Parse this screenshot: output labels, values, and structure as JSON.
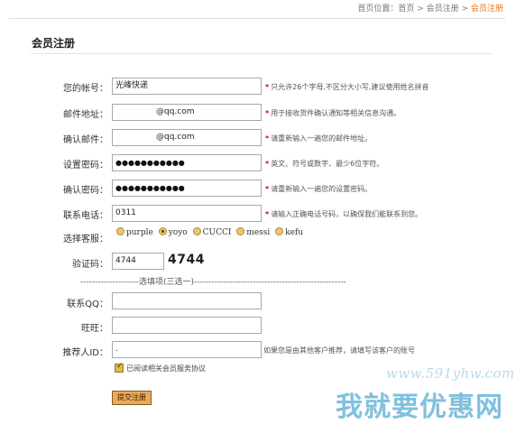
{
  "breadcrumb": {
    "prefix": "首页位置：",
    "home": "首页",
    "sep": ">",
    "members": "会员注册",
    "current": "会员注册"
  },
  "page_title": "会员注册",
  "fields": {
    "account": {
      "label": "您的帐号：",
      "value": "光峰快递",
      "hint": "只允许26个字母,不区分大小写,建议使用姓名拼音"
    },
    "email": {
      "label": "邮件地址：",
      "value": "@qq.com",
      "hint": "用于接收货件确认通知等相关信息沟通。"
    },
    "email_confirm": {
      "label": "确认邮件：",
      "value": "@qq.com",
      "hint": "请重新输入一遍您的邮件地址。"
    },
    "password": {
      "label": "设置密码：",
      "value": "●●●●●●●●●●●",
      "hint": "英文、符号或数字、最少6位字符。"
    },
    "password_confirm": {
      "label": "确认密码：",
      "value": "●●●●●●●●●●●",
      "hint": "请重新输入一遍您的设置密码。"
    },
    "phone": {
      "label": "联系电话：",
      "value": "0311",
      "hint": "请输入正确电话号码，以确保我们能联系到您。"
    }
  },
  "service": {
    "label": "选择客服：",
    "options": [
      "purple",
      "yoyo",
      "CUCCI",
      "messi",
      "kefu"
    ],
    "selected": "yoyo"
  },
  "captcha": {
    "label": "验证码：",
    "value": "4744",
    "image_text": "4744"
  },
  "optional_separator": "--------------------选填项(三选一)----------------------------------------------------",
  "optional": {
    "qq": {
      "label": "联系QQ：",
      "value": ""
    },
    "wangwang": {
      "label": "旺旺：",
      "value": ""
    },
    "referrer": {
      "label": "推荐人ID：",
      "value": ".",
      "hint": "如果您是由其他客户推荐，请填写该客户的账号"
    }
  },
  "agreement": {
    "label": "已阅读相关会员服务协议",
    "checked": true
  },
  "submit_label": "提交注册",
  "watermark": {
    "url": "www.591yhw.com",
    "text": "我就要优惠网"
  },
  "colors": {
    "accent": "#e8751a",
    "required_star": "#d40000",
    "button": "#e9a95b",
    "watermark": "#6ab6d9"
  }
}
